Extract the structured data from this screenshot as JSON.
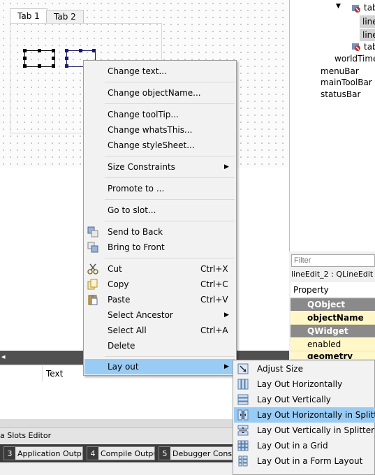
{
  "form": {
    "tabs": [
      "Tab 1",
      "Tab 2"
    ]
  },
  "object_tree": {
    "items": [
      {
        "label": "tab",
        "icon": "widget-icon"
      },
      {
        "label": "line"
      },
      {
        "label": "line"
      },
      {
        "label": "tab",
        "icon": "widget-icon"
      },
      {
        "label": "worldTime"
      },
      {
        "label": "menuBar"
      },
      {
        "label": "mainToolBar"
      },
      {
        "label": "statusBar"
      }
    ]
  },
  "property_editor": {
    "filter_placeholder": "Filter",
    "object_label": "lineEdit_2 : QLineEdit",
    "header": "Property",
    "groups": [
      {
        "name": "QObject",
        "rows": [
          "objectName"
        ]
      },
      {
        "name": "QWidget",
        "rows": [
          "enabled",
          "geometry"
        ]
      }
    ]
  },
  "bottom_panel": {
    "column_text": "Text",
    "slots_editor_tab": "a Slots Editor",
    "output_tabs": [
      {
        "num": "3",
        "label": "Application Output"
      },
      {
        "num": "4",
        "label": "Compile Output"
      },
      {
        "num": "5",
        "label": "Debugger Console"
      }
    ]
  },
  "context_menu": {
    "items": [
      {
        "label": "Change text..."
      },
      {
        "label": "Change objectName..."
      },
      {
        "label": "Change toolTip..."
      },
      {
        "label": "Change whatsThis..."
      },
      {
        "label": "Change styleSheet..."
      },
      {
        "label": "Size Constraints",
        "submenu": true
      },
      {
        "label": "Promote to ..."
      },
      {
        "label": "Go to slot..."
      },
      {
        "label": "Send to Back",
        "icon": "send-to-back-icon"
      },
      {
        "label": "Bring to Front",
        "icon": "bring-to-front-icon"
      },
      {
        "label": "Cut",
        "shortcut": "Ctrl+X",
        "icon": "scissors-icon"
      },
      {
        "label": "Copy",
        "shortcut": "Ctrl+C",
        "icon": "copy-icon"
      },
      {
        "label": "Paste",
        "shortcut": "Ctrl+V",
        "icon": "paste-icon"
      },
      {
        "label": "Select Ancestor",
        "submenu": true
      },
      {
        "label": "Select All",
        "shortcut": "Ctrl+A"
      },
      {
        "label": "Delete"
      },
      {
        "label": "Lay out",
        "submenu": true,
        "highlighted": true
      }
    ]
  },
  "layout_submenu": {
    "items": [
      {
        "label": "Adjust Size",
        "icon": "adjust-size-icon"
      },
      {
        "label": "Lay Out Horizontally",
        "icon": "horizontal-layout-icon"
      },
      {
        "label": "Lay Out Vertically",
        "icon": "vertical-layout-icon"
      },
      {
        "label": "Lay Out Horizontally in Splitter",
        "icon": "horizontal-splitter-icon",
        "highlighted": true
      },
      {
        "label": "Lay Out Vertically in Splitter",
        "icon": "vertical-splitter-icon"
      },
      {
        "label": "Lay Out in a Grid",
        "icon": "grid-layout-icon"
      },
      {
        "label": "Lay Out in a Form Layout",
        "icon": "form-layout-icon"
      }
    ]
  },
  "colors": {
    "highlight": "#99ccf5",
    "group_header": "#8a8a8a",
    "property_row": "#fff7c8"
  }
}
